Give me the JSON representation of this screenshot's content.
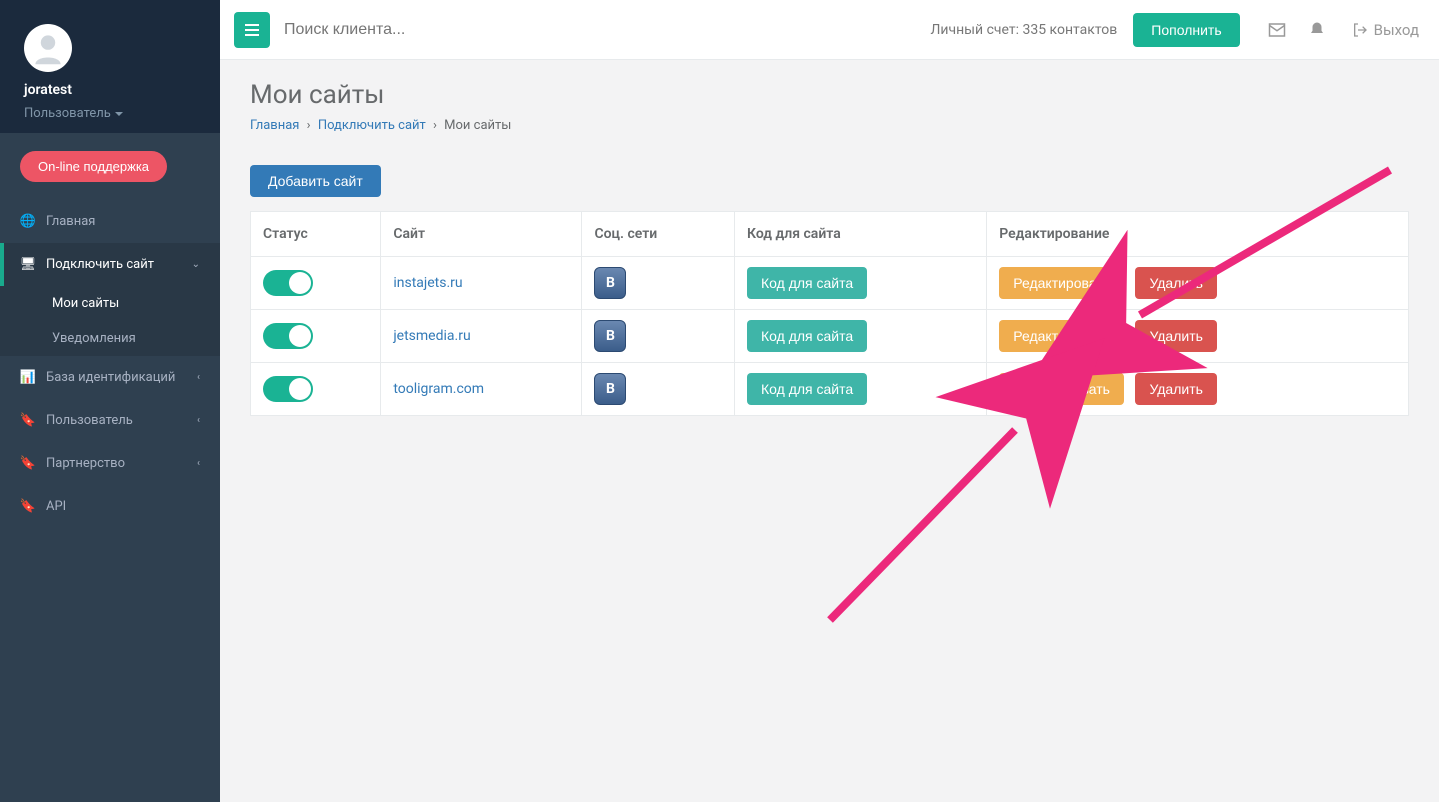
{
  "user": {
    "name": "joratest",
    "role": "Пользователь"
  },
  "support": "On-line поддержка",
  "search_placeholder": "Поиск клиента...",
  "account": {
    "label": "Личный счет: 335 контактов",
    "topup": "Пополнить"
  },
  "logout": "Выход",
  "nav": {
    "home": "Главная",
    "connect": "Подключить сайт",
    "my_sites": "Мои сайты",
    "notifications": "Уведомления",
    "ident_db": "База идентификаций",
    "user": "Пользователь",
    "partner": "Партнерство",
    "api": "API"
  },
  "page": {
    "title": "Мои сайты",
    "breadcrumb": {
      "home": "Главная",
      "connect": "Подключить сайт",
      "current": "Мои сайты"
    },
    "add_site": "Добавить сайт"
  },
  "table": {
    "headers": {
      "status": "Статус",
      "site": "Сайт",
      "social": "Соц. сети",
      "code": "Код для сайта",
      "editing": "Редактирование"
    },
    "code_button": "Код для сайта",
    "edit_button": "Редактировать",
    "delete_button": "Удалить",
    "rows": [
      {
        "site": "instajets.ru"
      },
      {
        "site": "jetsmedia.ru"
      },
      {
        "site": "tooligram.com"
      }
    ]
  }
}
